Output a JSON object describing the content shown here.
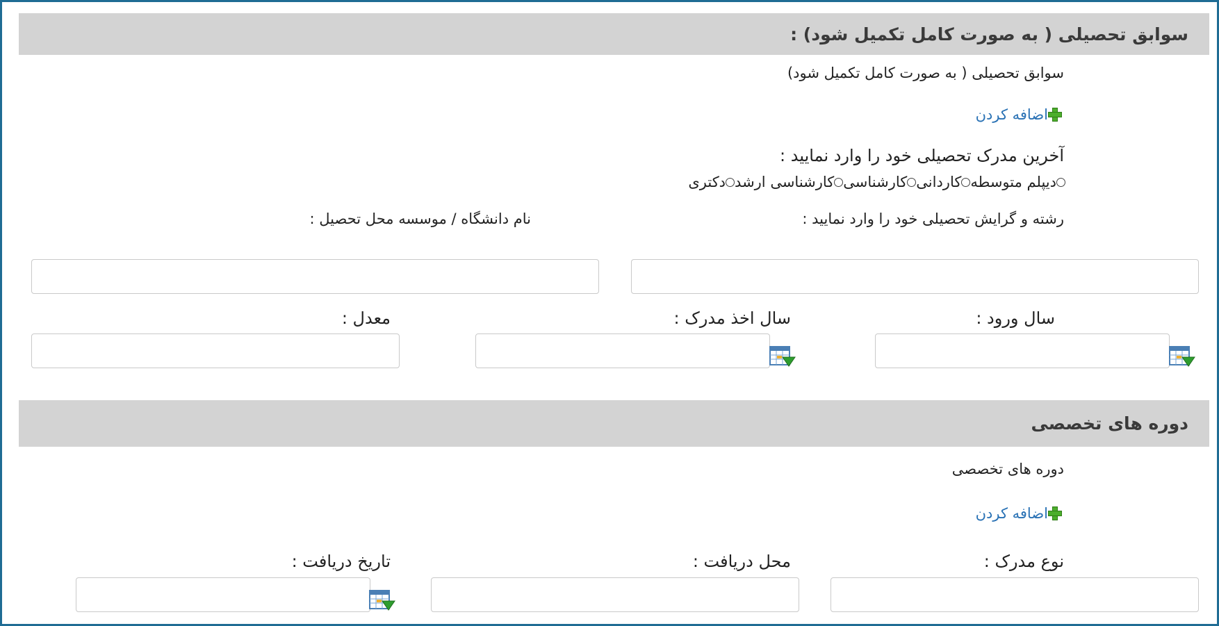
{
  "education": {
    "header_title": "سوابق تحصیلی ( به صورت کامل تکمیل شود) :",
    "caption": "سوابق تحصیلی ( به صورت کامل تکمیل شود)",
    "add_label": "اضافه کردن",
    "degree_question": "آخرین مدرک تحصیلی خود را وارد نمایید :",
    "degree_options": [
      "دیپلم متوسطه",
      "کاردانی",
      "کارشناسی",
      "کارشناسی ارشد",
      "دکتری"
    ],
    "field_label": "رشته و گرایش تحصیلی خود را وارد نمایید :",
    "university_label": "نام دانشگاه / موسسه محل تحصیل :",
    "entry_year_label": "سال ورود :",
    "graduation_year_label": "سال اخذ مدرک :",
    "gpa_label": "معدل :"
  },
  "courses": {
    "header_title": "دوره های تخصصی",
    "caption": "دوره های تخصصی",
    "add_label": "اضافه کردن",
    "cert_type_label": "نوع مدرک :",
    "place_label": "محل دریافت :",
    "date_label": "تاریخ دریافت :"
  },
  "icons": {
    "add": "plus-icon",
    "calendar": "calendar-icon"
  },
  "colors": {
    "frame_border": "#1f6c94",
    "section_header_bg": "#d3d3d3",
    "link": "#2a72b5",
    "plus_green": "#4cae2c"
  }
}
